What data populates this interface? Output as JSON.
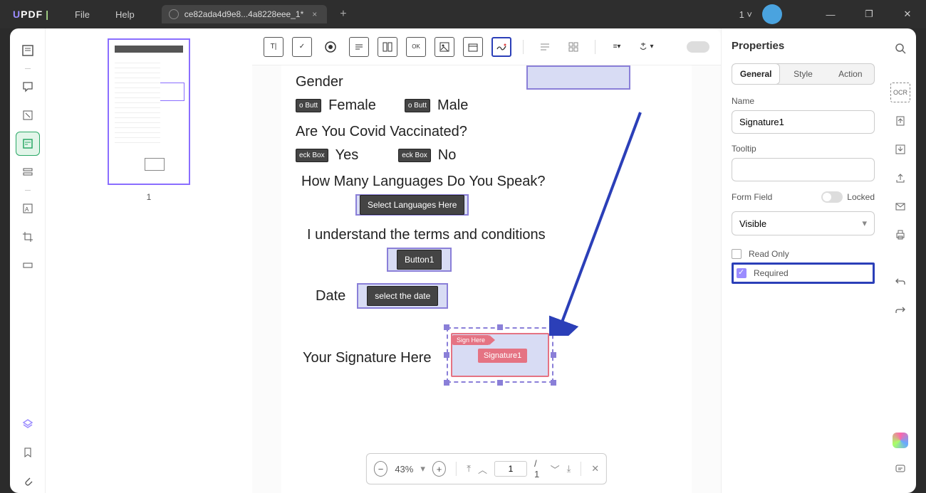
{
  "title": {
    "menu_file": "File",
    "menu_help": "Help",
    "tab_name": "ce82ada4d9e8...4a8228eee_1*",
    "tab_count": "1 ˅"
  },
  "thumbnail": {
    "page_num": "1"
  },
  "form": {
    "gender_label": "Gender",
    "female": "Female",
    "male": "Male",
    "radio_tag": "o Butt",
    "covid_q": "Are You Covid Vaccinated?",
    "yes": "Yes",
    "no": "No",
    "check_tag": "eck Box",
    "lang_q": "How Many Languages Do You Speak?",
    "lang_select": "Select Languages Here",
    "terms": "I understand the terms and conditions",
    "button1": "Button1",
    "date_label": "Date",
    "date_btn": "select the date",
    "sig_label": "Your Signature Here",
    "sig_here": "Sign Here",
    "sig_name": "Signature1"
  },
  "footer": {
    "zoom": "43%",
    "page_cur": "1",
    "page_total": "/  1"
  },
  "props": {
    "title": "Properties",
    "tab_general": "General",
    "tab_style": "Style",
    "tab_action": "Action",
    "name_label": "Name",
    "name_value": "Signature1",
    "tooltip_label": "Tooltip",
    "tooltip_value": "",
    "formfield_label": "Form Field",
    "locked_label": "Locked",
    "visible": "Visible",
    "readonly": "Read Only",
    "required": "Required"
  }
}
